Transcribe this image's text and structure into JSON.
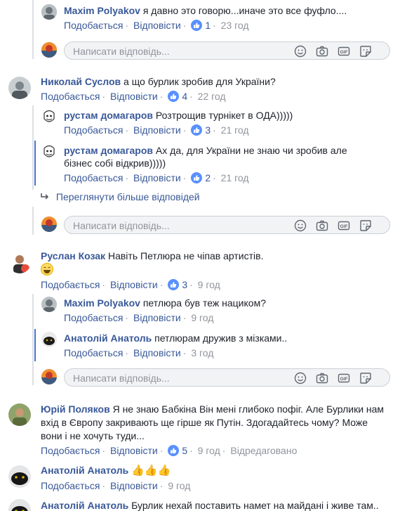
{
  "actions": {
    "like": "Подобається",
    "reply": "Відповісти",
    "edited": "Відредаговано",
    "reply_placeholder": "Написати відповідь...",
    "more_replies": "Переглянути більше відповідей"
  },
  "c1": {
    "author": "Maxim Polyakov",
    "text": "я давно это говорю...иначе это все фуфло....",
    "likes": "1",
    "time": "23 год"
  },
  "c2": {
    "author": "Николай Суслов",
    "text": "а що бурлик зробив для України?",
    "likes": "4",
    "time": "22 год"
  },
  "c2r1": {
    "author": "рустам домагаров",
    "text": "Розтрощив турнікет в ОДА)))))",
    "likes": "3",
    "time": "21 год"
  },
  "c2r2": {
    "author": "рустам домагаров",
    "text_line1": "Ах да, для України не знаю чи зробив але",
    "text_line2": "бізнес собі відкрив)))))",
    "likes": "2",
    "time": "21 год"
  },
  "c3": {
    "author": "Руслан Козак",
    "text": "Навіть Петлюра не чіпав артистів.",
    "likes": "3",
    "time": "9 год"
  },
  "c3r1": {
    "author": "Maxim Polyakov",
    "text": "петлюра був теж нациком?",
    "time": "9 год"
  },
  "c3r2": {
    "author": "Анатолій Анатоль",
    "text": "петлюрам дружив з мізками..",
    "time": "3 год"
  },
  "c4": {
    "author": "Юрій Поляков",
    "text_line1": "Я не знаю Бабкіна Він мені глибоко пофіг. Але Бурлики нам",
    "text_line2": "вхід в Європу закривають ще гірше як Путін. Здогадайтесь чому? Може",
    "text_line3": "вони і не хочуть туди...",
    "likes": "5",
    "time": "9 год"
  },
  "c5": {
    "author": "Анатолій Анатоль",
    "time": "9 год"
  },
  "c6": {
    "author": "Анатолій Анатоль",
    "text": "Бурлик нехай поставить намет на майдані і живе там.."
  },
  "colors": {
    "link": "#385898",
    "like_blue": "#5890ff",
    "reply_bg": "#f2f3f5"
  }
}
